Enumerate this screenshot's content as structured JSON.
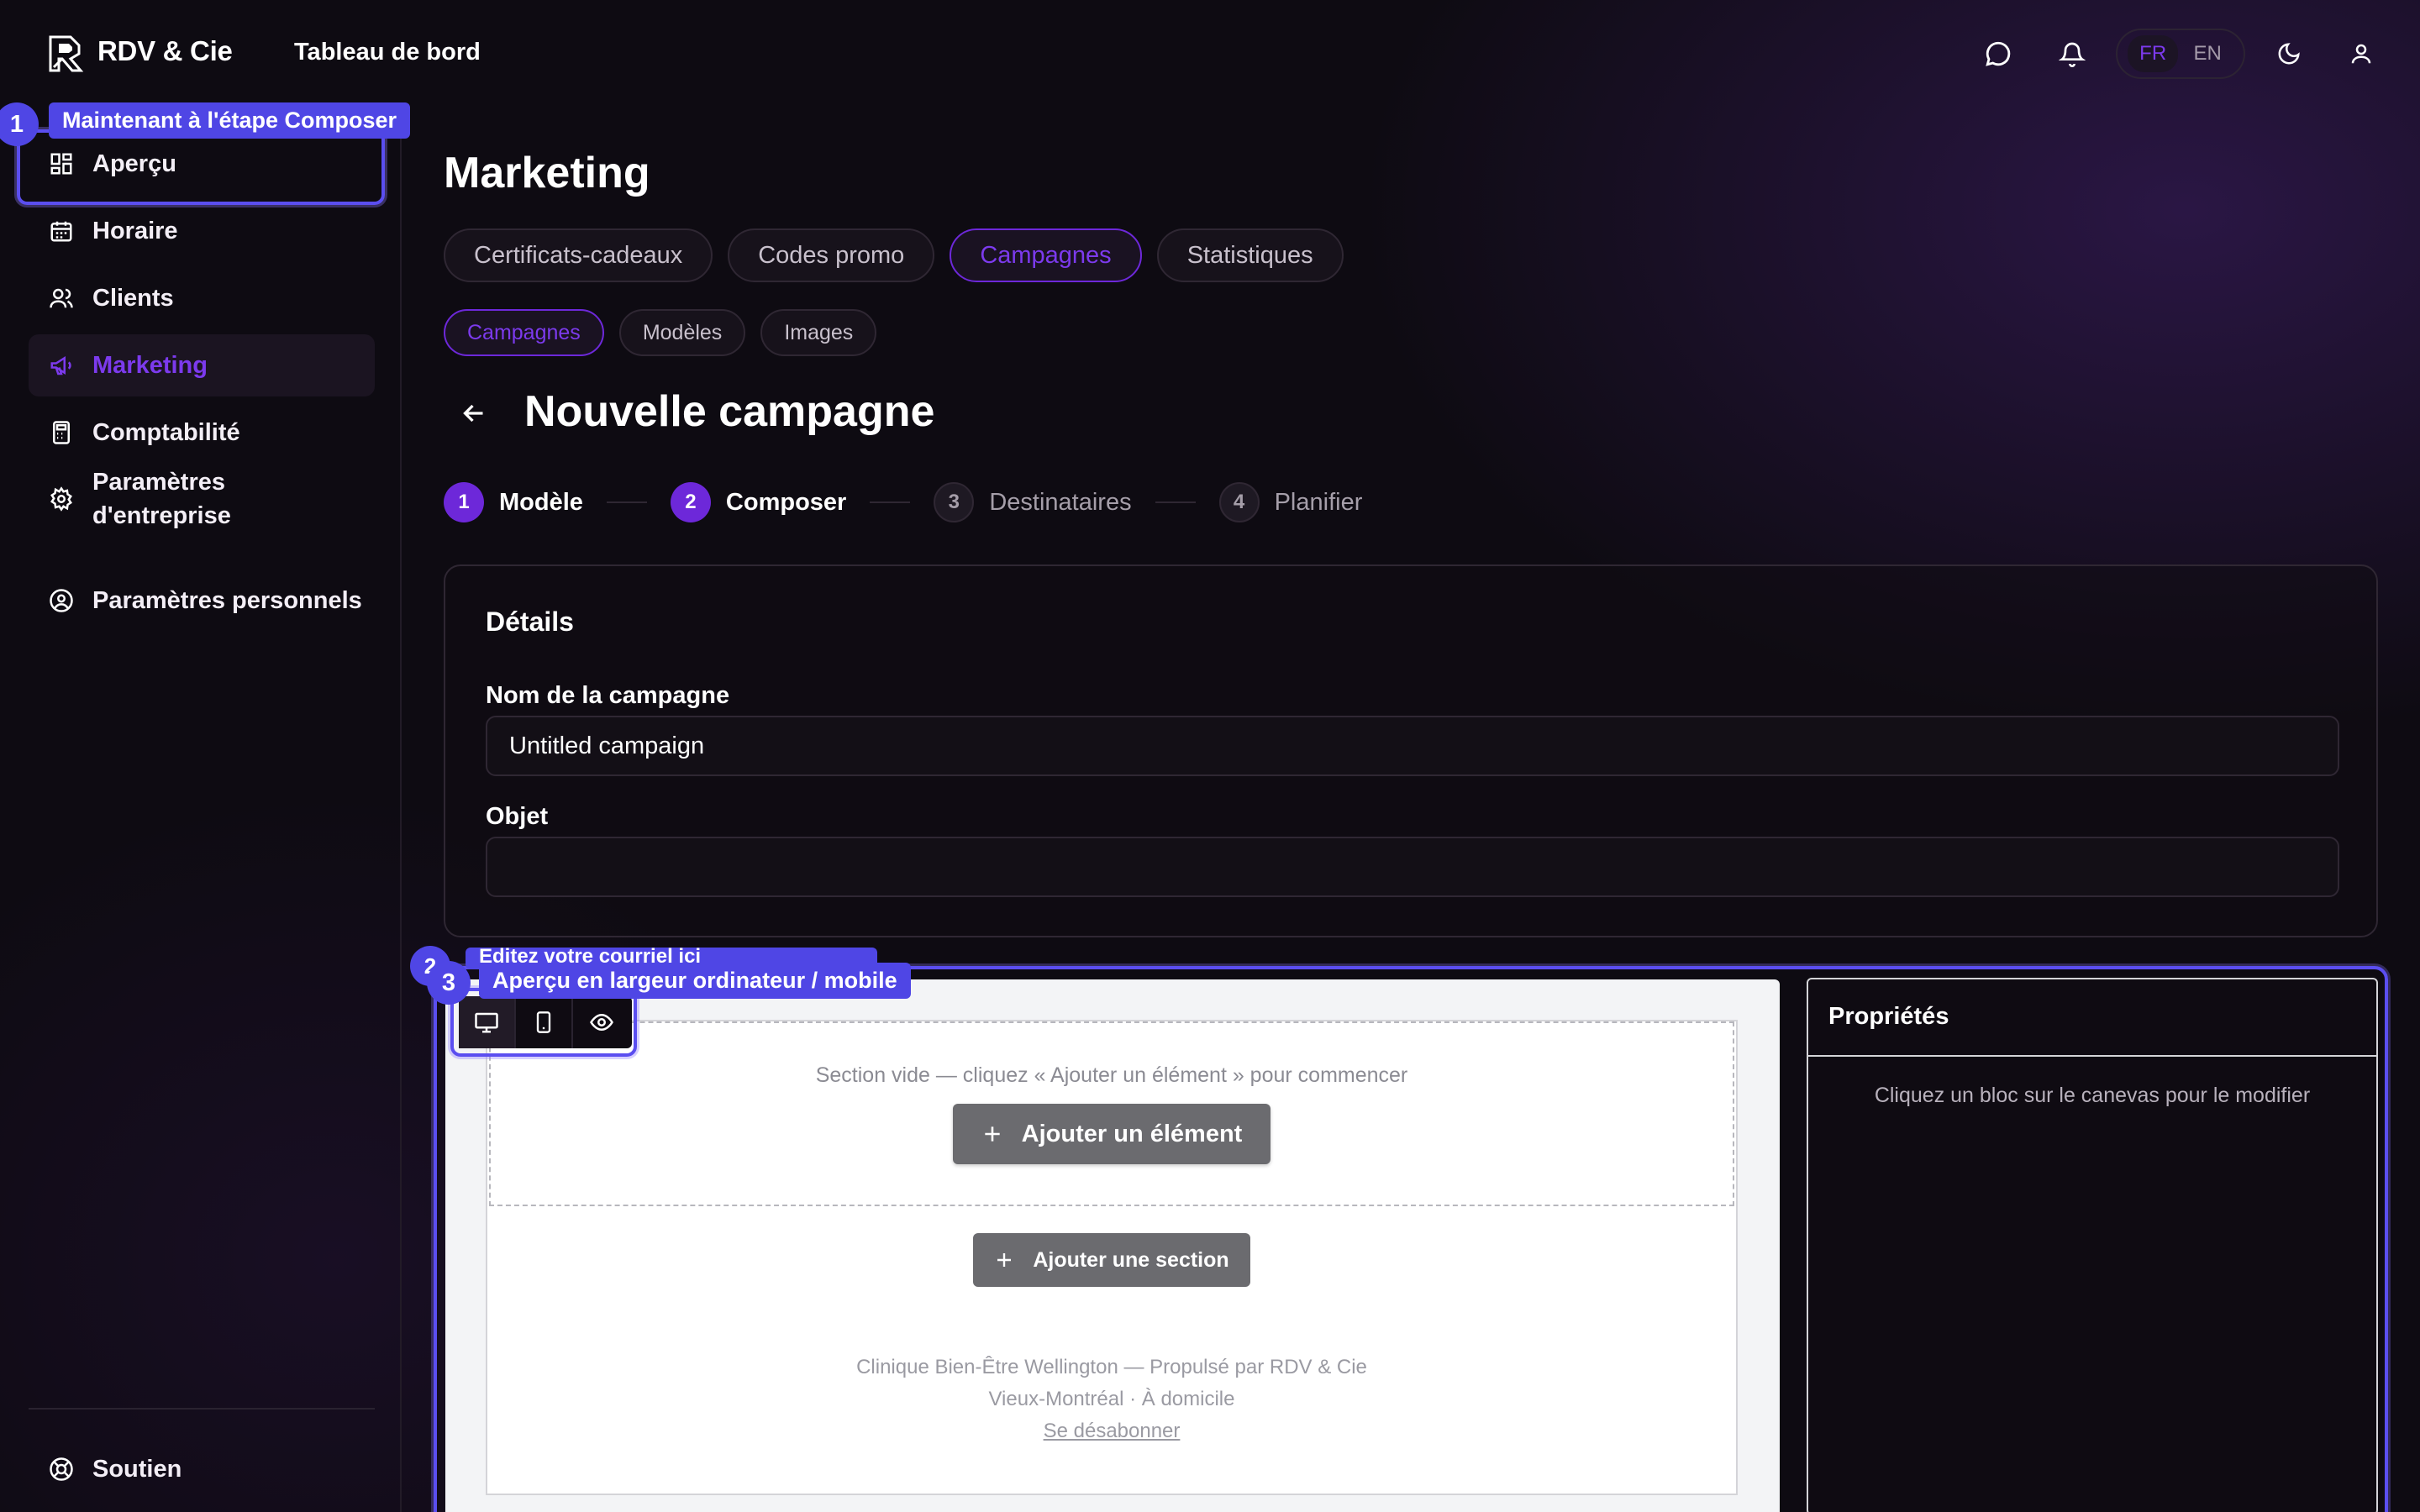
{
  "header": {
    "brand": "RDV & Cie",
    "nav_label": "Tableau de bord",
    "lang_fr": "FR",
    "lang_en": "EN",
    "icons": [
      "chat-icon",
      "bell-icon",
      "moon-icon",
      "user-icon"
    ]
  },
  "sidebar": {
    "items": [
      {
        "label": "Aperçu",
        "icon": "grid-icon"
      },
      {
        "label": "Horaire",
        "icon": "calendar-icon"
      },
      {
        "label": "Clients",
        "icon": "users-icon"
      },
      {
        "label": "Marketing",
        "icon": "megaphone-icon",
        "active": true
      },
      {
        "label": "Comptabilité",
        "icon": "calculator-icon"
      },
      {
        "label_line1": "Paramètres",
        "label_line2": "d'entreprise",
        "icon": "gear-icon"
      },
      {
        "label": "Paramètres personnels",
        "icon": "user-circle-icon"
      }
    ],
    "support_label": "Soutien"
  },
  "tour": {
    "step1_number": "1",
    "step1_label": "Maintenant à l'étape Composer",
    "step3_number": "3",
    "step3_label": "Aperçu en largeur ordinateur / mobile",
    "step2_hidden_label": "Éditez votre courriel ici"
  },
  "main": {
    "title": "Marketing",
    "tabs": [
      "Certificats-cadeaux",
      "Codes promo",
      "Campagnes",
      "Statistiques"
    ],
    "active_tab": "Campagnes",
    "subtabs": [
      "Campagnes",
      "Modèles",
      "Images"
    ],
    "active_subtab": "Campagnes",
    "subtitle": "Nouvelle campagne",
    "steps": [
      {
        "num": "1",
        "label": "Modèle",
        "state": "done"
      },
      {
        "num": "2",
        "label": "Composer",
        "state": "current"
      },
      {
        "num": "3",
        "label": "Destinataires",
        "state": "pending"
      },
      {
        "num": "4",
        "label": "Planifier",
        "state": "pending"
      }
    ]
  },
  "details": {
    "title": "Détails",
    "name_label": "Nom de la campagne",
    "name_value": "Untitled campaign",
    "subject_label": "Objet",
    "subject_value": ""
  },
  "editor": {
    "empty_section_text": "Section vide — cliquez « Ajouter un élément » pour commencer",
    "add_element": "Ajouter un élément",
    "add_section": "Ajouter une section",
    "footer_line1": "Clinique Bien-Être Wellington — Propulsé par RDV & Cie",
    "footer_line2": "Vieux-Montréal · À domicile",
    "unsubscribe": "Se désabonner",
    "view_modes": [
      "desktop-icon",
      "mobile-icon",
      "eye-icon"
    ]
  },
  "properties": {
    "title": "Propriétés",
    "hint": "Cliquez un bloc sur le canevas pour le modifier"
  },
  "colors": {
    "accent": "#7c3aed",
    "tour_blue": "#4f46e5",
    "background": "#0f0b12"
  }
}
